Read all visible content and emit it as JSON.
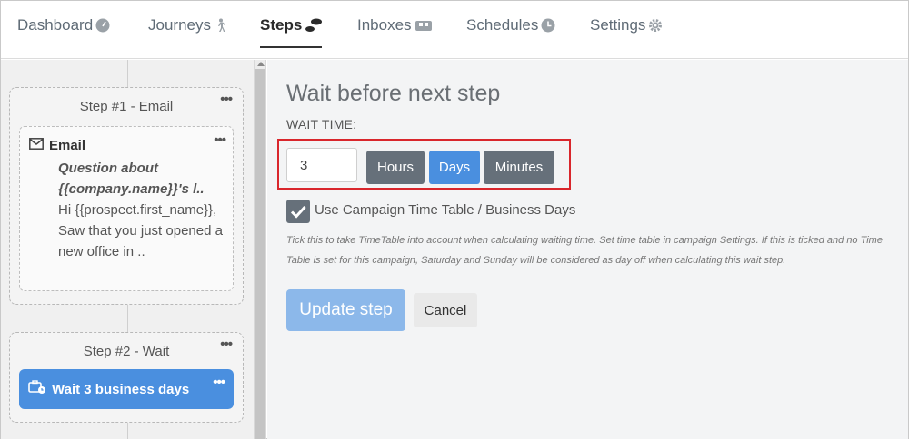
{
  "nav": {
    "tabs": [
      {
        "label": "Dashboard",
        "icon": "gauge-icon"
      },
      {
        "label": "Journeys",
        "icon": "walking-person-icon"
      },
      {
        "label": "Steps",
        "icon": "footsteps-icon"
      },
      {
        "label": "Inboxes",
        "icon": "inbox-icon"
      },
      {
        "label": "Schedules",
        "icon": "clock-icon"
      },
      {
        "label": "Settings",
        "icon": "gear-icon"
      }
    ],
    "active_tab": "Steps"
  },
  "sidebar": {
    "step1": {
      "title": "Step #1 - Email",
      "menu": "•••",
      "card": {
        "type_label": "Email",
        "menu": "•••",
        "subject": "Question about {{company.name}}'s l..",
        "preview": "Hi {{prospect.first_name}}, Saw that you just opened a new office in .."
      }
    },
    "step2": {
      "title": "Step #2 - Wait",
      "menu": "•••",
      "button_label": "Wait 3 business days",
      "button_menu": "•••"
    }
  },
  "main": {
    "heading": "Wait before next step",
    "wait_time_label": "WAIT TIME:",
    "wait_value": "3",
    "units": [
      {
        "label": "Hours",
        "selected": false
      },
      {
        "label": "Days",
        "selected": true
      },
      {
        "label": "Minutes",
        "selected": false
      }
    ],
    "checkbox_label": "Use Campaign Time Table / Business Days",
    "checkbox_checked": true,
    "help_text": "Tick this to take TimeTable into account when calculating waiting time. Set time table in campaign Settings. If this is ticked and no Time Table is set for this campaign, Saturday and Sunday will be considered as day off when calculating this wait step.",
    "update_label": "Update step",
    "cancel_label": "Cancel"
  },
  "colors": {
    "accent": "#4a8fdf",
    "button_gray": "#66707a",
    "highlight_box": "#d9262c",
    "update_disabled": "#8cb8ea"
  }
}
